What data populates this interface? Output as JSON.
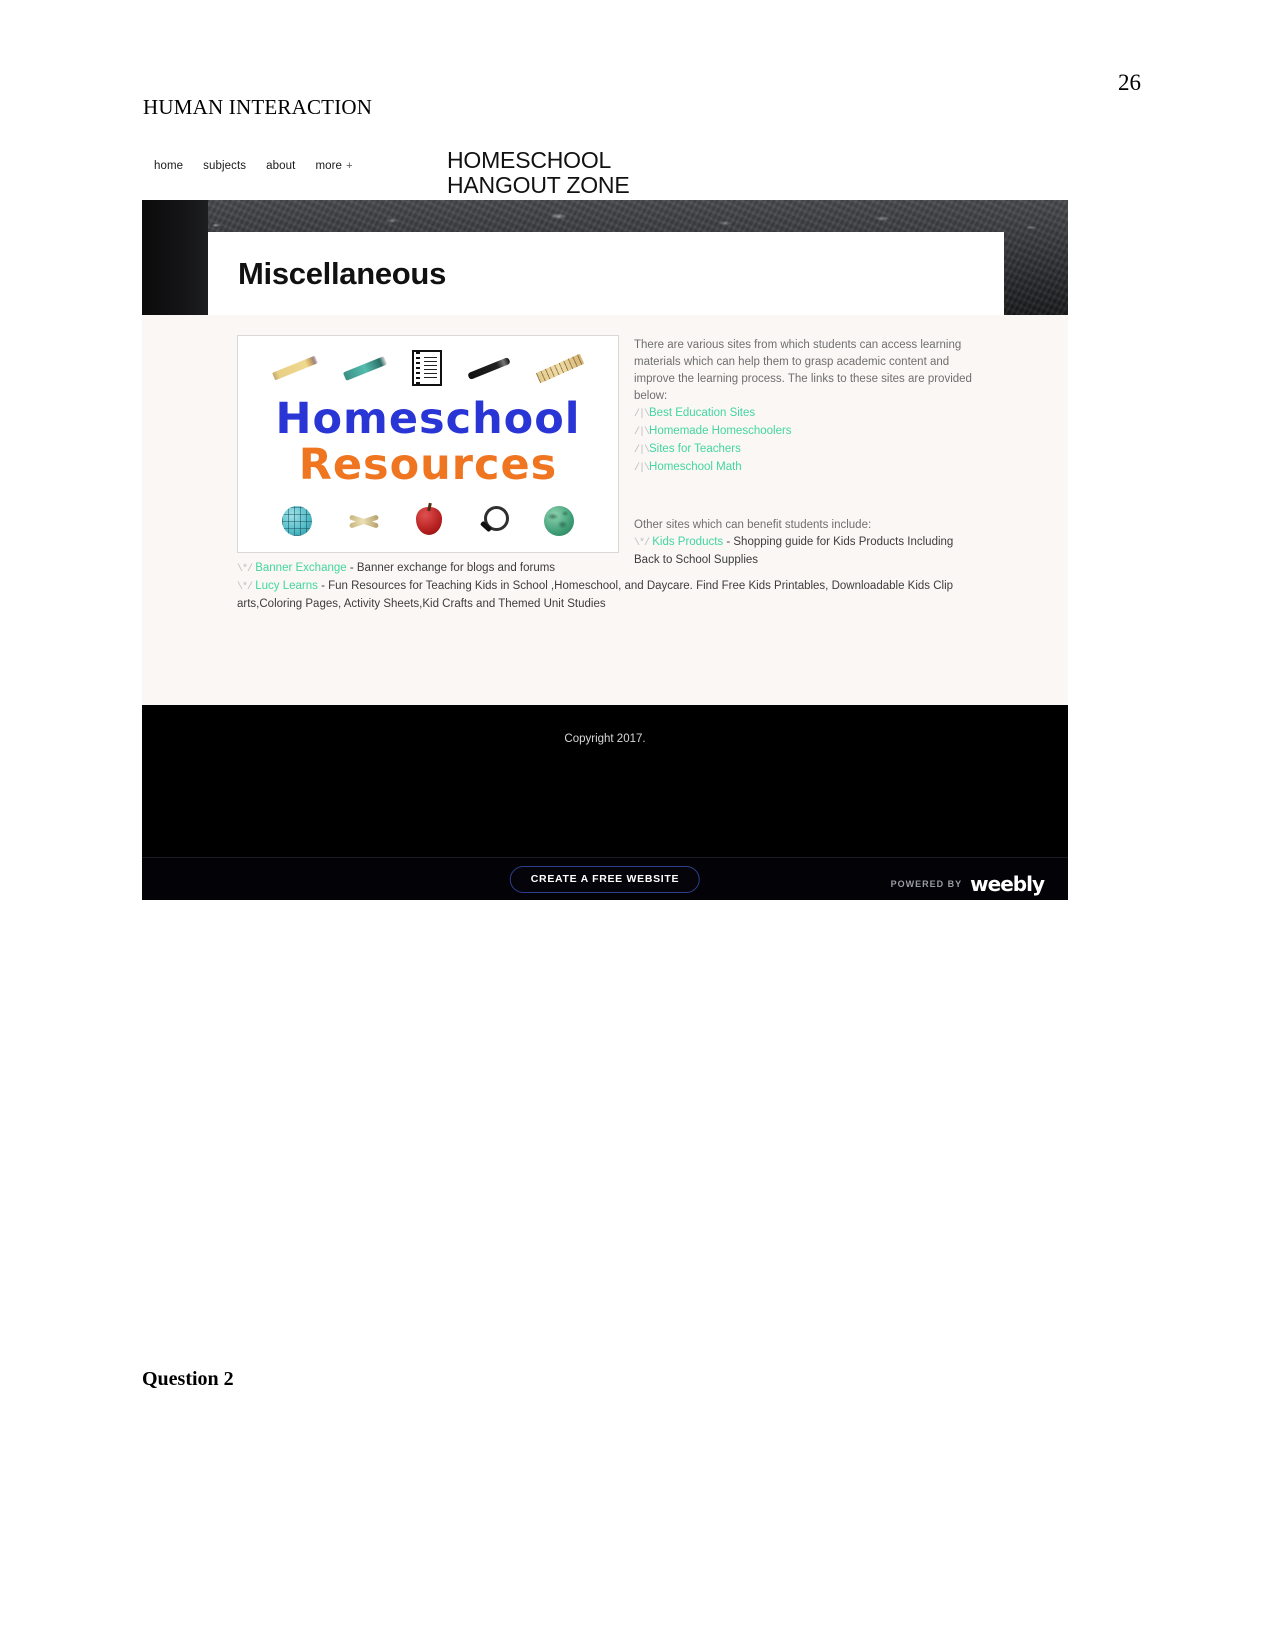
{
  "document": {
    "page_number": "26",
    "running_head": "HUMAN INTERACTION",
    "question_label": "Question 2"
  },
  "site": {
    "nav": {
      "items": [
        {
          "label": "home"
        },
        {
          "label": "subjects"
        },
        {
          "label": "about"
        },
        {
          "label": "more"
        }
      ],
      "more_plus": "+"
    },
    "brand": {
      "line1": "HOMESCHOOL",
      "line2": "HANGOUT ZONE"
    },
    "hero": {
      "title": "Miscellaneous"
    },
    "figure": {
      "word1": "Homeschool",
      "word2": "Resources",
      "top_icons": [
        "pencil-icon",
        "green-marker-icon",
        "notebook-icon",
        "pen-icon",
        "ruler-icon"
      ],
      "bottom_icons": [
        "blue-globe-icon",
        "scissors-icon",
        "apple-icon",
        "magnifier-icon",
        "green-globe-icon"
      ]
    },
    "intro": {
      "paragraph": "There are various sites from which students can access learning materials which can help them to grasp academic content and improve the learning process. The links to these sites are provided below:",
      "link_marker": "/|\\",
      "links": [
        {
          "label": "Best Education Sites"
        },
        {
          "label": "Homemade Homeschoolers"
        },
        {
          "label": "Sites for Teachers"
        },
        {
          "label": "Homeschool Math"
        }
      ]
    },
    "other_sites": {
      "heading": "Other sites which can benefit students include:",
      "link_marker": "\\*/",
      "entries": [
        {
          "link": "Kids Products",
          "description": " - Shopping guide for Kids Products Including Back to School Supplies"
        }
      ]
    },
    "bottom_entries": {
      "link_marker": "\\*/",
      "entries": [
        {
          "link": "Banner Exchange",
          "description": " - Banner exchange for blogs and forums"
        },
        {
          "link": "Lucy Learns",
          "description": " - Fun Resources for Teaching Kids in School ,Homeschool, and Daycare. Find Free Kids Printables, Downloadable Kids Clip arts,Coloring Pages, Activity Sheets,Kid Crafts and Themed Unit Studies"
        }
      ]
    },
    "footer": {
      "copyright": "Copyright 2017.",
      "create_button": "CREATE A FREE WEBSITE",
      "powered_by_label": "POWERED BY",
      "powered_by_logo": "weebly"
    },
    "colors": {
      "link_green": "#43d6a0",
      "word1_blue": "#2a35d6",
      "word2_orange": "#ef7521",
      "content_bg": "#faf7f5",
      "footer_bg": "#000000"
    }
  }
}
